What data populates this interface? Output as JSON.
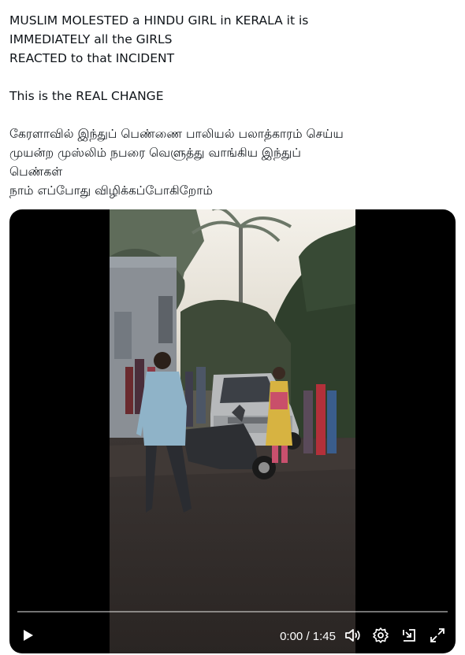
{
  "post": {
    "lines": [
      "MUSLIM MOLESTED a HINDU GIRL in KERALA it is",
      "IMMEDIATELY all the GIRLS",
      "REACTED to that INCIDENT",
      "",
      "This is the REAL CHANGE",
      "",
      "கேரளாவில் இந்துப் பெண்ணை பாலியல் பலாத்காரம் செய்ய",
      "முயன்ற முஸ்லிம் நபரை வெளுத்து வாங்கிய இந்துப்",
      "பெண்கள்",
      " நாம் எப்போது விழிக்கப்போகிறோம்"
    ]
  },
  "video": {
    "current_time": "0:00",
    "separator": " / ",
    "duration": "1:45",
    "progress": 0.0,
    "controls": {
      "play_icon": "play-icon",
      "volume_icon": "volume-icon",
      "settings_icon": "gear-icon",
      "minimize_icon": "pip-icon",
      "fullscreen_icon": "expand-icon"
    }
  },
  "colors": {
    "text": "#0f1419",
    "video_bg": "#000000",
    "controls": "#ffffff"
  }
}
